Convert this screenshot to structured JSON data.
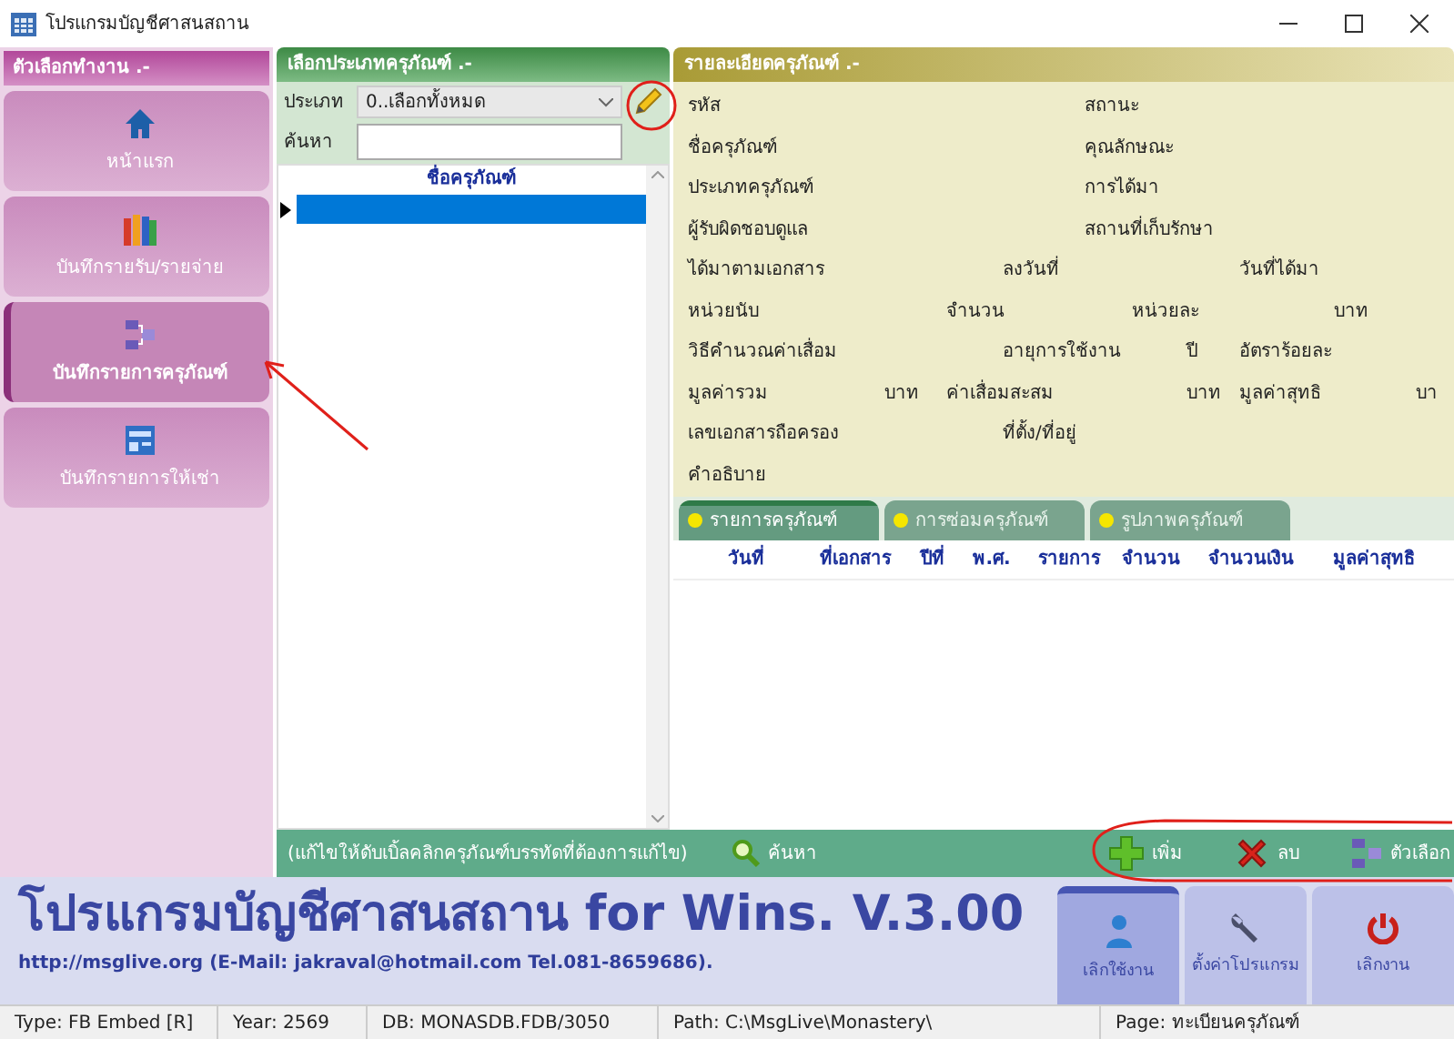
{
  "window": {
    "title": "โปรแกรมบัญชีศาสนสถาน"
  },
  "sidebar": {
    "title": "ตัวเลือกทำงาน .-",
    "items": [
      {
        "label": "หน้าแรก",
        "kind": "home",
        "selected": false
      },
      {
        "label": "บันทึกรายรับ/รายจ่าย",
        "kind": "books",
        "selected": false
      },
      {
        "label": "บันทึกรายการครุภัณฑ์",
        "kind": "diagram",
        "selected": true
      },
      {
        "label": "บันทึกรายการให้เช่า",
        "kind": "news",
        "selected": false
      }
    ]
  },
  "asset_types": {
    "title": "เลือกประเภทครุภัณฑ์ .-",
    "type_label": "ประเภท",
    "type_value": "0..เลือกทั้งหมด",
    "search_label": "ค้นหา",
    "column": "ชื่อครุภัณฑ์",
    "rows": [
      {
        "selected": true
      }
    ]
  },
  "details": {
    "title": "รายละเอียดครุภัณฑ์ .-",
    "rows": [
      [
        "รหัส",
        "",
        "",
        "",
        "สถานะ"
      ],
      [
        "ชื่อครุภัณฑ์",
        "",
        "",
        "",
        "คุณลักษณะ"
      ],
      [
        "ประเภทครุภัณฑ์",
        "",
        "",
        "",
        "การได้มา"
      ],
      [
        "ผู้รับผิดชอบดูแล",
        "",
        "",
        "",
        "สถานที่เก็บรักษา"
      ],
      [
        "ได้มาตามเอกสาร",
        "",
        "",
        "ลงวันที่",
        "",
        "",
        "",
        "วันที่ได้มา"
      ],
      [
        "หน่วยนับ",
        "",
        "จำนวน",
        "",
        "",
        "หน่วยละ",
        "",
        "",
        "บาท"
      ],
      [
        "วิธีคำนวณค่าเสื่อม",
        "",
        "",
        "อายุการใช้งาน",
        "",
        "",
        "ปี",
        "อัตราร้อยละ"
      ],
      [
        "มูลค่ารวม",
        "บาท",
        "ค่าเสื่อมสะสม",
        "",
        "",
        "",
        "บาท",
        "มูลค่าสุทธิ",
        "",
        "บา"
      ],
      [
        "เลขเอกสารถือครอง",
        "",
        "",
        "ที่ตั้ง/ที่อยู่"
      ],
      [
        "คำอธิบาย"
      ]
    ]
  },
  "tabs": [
    {
      "label": "รายการครุภัณฑ์",
      "selected": true
    },
    {
      "label": "การซ่อมครุภัณฑ์",
      "selected": false
    },
    {
      "label": "รูปภาพครุภัณฑ์",
      "selected": false
    }
  ],
  "table": {
    "columns": [
      "วันที่",
      "ที่เอกสาร",
      "ปีที่",
      "พ.ศ.",
      "รายการ",
      "จำนวน",
      "จำนวนเงิน",
      "มูลค่าสุทธิ"
    ]
  },
  "action_bar": {
    "hint": "(แก้ไขให้ดับเบิ้ลคลิกครุภัณฑ์บรรทัดที่ต้องการแก้ไข)",
    "search": "ค้นหา",
    "buttons": [
      {
        "label": "เพิ่ม",
        "kind": "add"
      },
      {
        "label": "ลบ",
        "kind": "delete"
      },
      {
        "label": "ตัวเลือก",
        "kind": "options"
      }
    ]
  },
  "footer": {
    "title": "โปรแกรมบัญชีศาสนสถาน for Wins. V.3.00",
    "contact": "http://msglive.org (E-Mail: jakraval@hotmail.com Tel.081-8659686).",
    "buttons": [
      {
        "label": "เลิกใช้งาน",
        "kind": "user",
        "selected": true
      },
      {
        "label": "ตั้งค่าโปรแกรม",
        "kind": "settings",
        "selected": false
      },
      {
        "label": "เลิกงาน",
        "kind": "power",
        "selected": false
      }
    ]
  },
  "status_bar": [
    "Type: FB Embed [R]",
    "Year: 2569",
    "DB: MONASDB.FDB/3050",
    "Path: C:\\MsgLive\\Monastery\\",
    "Page: ทะเบียนครุภัณฑ์"
  ]
}
